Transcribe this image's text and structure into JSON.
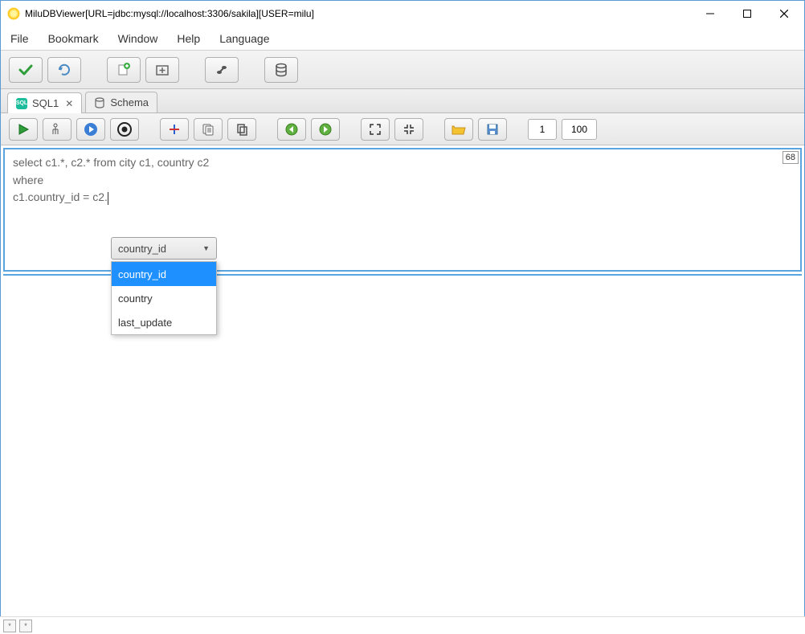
{
  "window": {
    "title": "MiluDBViewer[URL=jdbc:mysql://localhost:3306/sakila][USER=milu]"
  },
  "menu": {
    "file": "File",
    "bookmark": "Bookmark",
    "window": "Window",
    "help": "Help",
    "language": "Language"
  },
  "tabs": {
    "sql1": "SQL1",
    "schema": "Schema"
  },
  "inputs": {
    "start": "1",
    "limit": "100"
  },
  "editor": {
    "line1": "select c1.*, c2.* from city c1, country c2",
    "line2": "where",
    "line3": "c1.country_id = c2.",
    "counter": "68"
  },
  "autocomplete": {
    "selected": "country_id",
    "options": [
      "country_id",
      "country",
      "last_update"
    ]
  },
  "status": {
    "cell1": "*",
    "cell2": "*"
  }
}
